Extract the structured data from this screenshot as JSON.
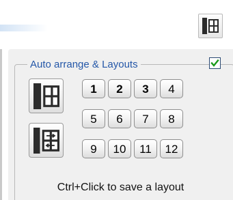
{
  "toolbar": {
    "icon": "grid-layout-icon"
  },
  "group": {
    "title": "Auto arrange & Layouts",
    "enabled_checked": true,
    "check_color": "#1a9a1a",
    "title_color": "#2457a8"
  },
  "actions": {
    "auto_arrange_icon": "grid-layout-icon",
    "rearrange_icon": "rearrange-windows-icon"
  },
  "layouts": [
    "1",
    "2",
    "3",
    "4",
    "5",
    "6",
    "7",
    "8",
    "9",
    "10",
    "11",
    "12"
  ],
  "bold_layouts": [
    "1",
    "2",
    "3"
  ],
  "hint": "Ctrl+Click to save a layout"
}
